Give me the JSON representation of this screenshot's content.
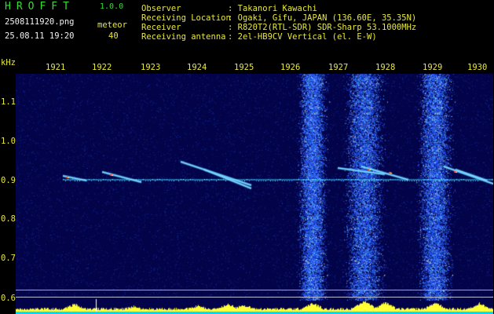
{
  "header": {
    "app_title": "HROFFT",
    "version": "1.0.0",
    "filename": "2508111920.png",
    "timestamp": "25.08.11 19:20",
    "meteor_label": "meteor",
    "meteor_count": "40"
  },
  "info": {
    "labels": [
      "Observer",
      "Receiving Location",
      "Receiver",
      "Receiving antenna"
    ],
    "values": [
      ": Takanori Kawachi",
      ": Ogaki, Gifu, JAPAN (136.60E, 35.35N)",
      ": R820T2(RTL-SDR) SDR-Sharp 53.1000MHz",
      ": 2el-HB9CV Vertical (el. E-W)"
    ]
  },
  "axes": {
    "freq_unit": "kHz",
    "time_ticks": [
      "1921",
      "1922",
      "1923",
      "1924",
      "1925",
      "1926",
      "1927",
      "1928",
      "1929",
      "1930"
    ],
    "freq_ticks": [
      "1.1",
      "1.0",
      "0.9",
      "0.8",
      "0.7",
      "0.6"
    ]
  },
  "colors": {
    "background": "#000000",
    "spectrogram_bg": "#03034a",
    "noise": "#2a58ff",
    "carrier": "#3fd6ff",
    "meteor": "#c8f0ff",
    "text_green": "#33dd33",
    "text_yellow": "#e8e83a",
    "activity_bar": "#ffff33",
    "baseline": "#00d8ff"
  }
}
